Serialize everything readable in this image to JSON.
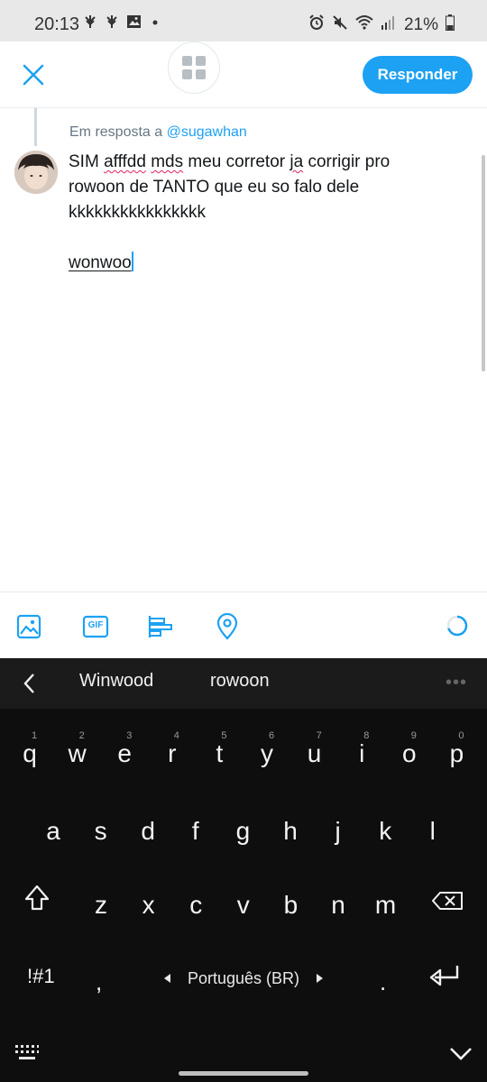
{
  "status_bar": {
    "time": "20:13",
    "battery_percent": "21%",
    "left_icons": [
      "paw-icon",
      "paw-icon",
      "gallery-icon",
      "dot-icon"
    ],
    "right_icons": [
      "alarm-icon",
      "mute-icon",
      "wifi-icon",
      "signal-icon",
      "battery-icon"
    ]
  },
  "header": {
    "reply_button_label": "Responder",
    "close_icon": "close-icon",
    "drafts_icon": "grid-icon"
  },
  "compose": {
    "reply_prefix": "Em resposta a",
    "reply_handle": "@sugawhan",
    "text_line1_a": "SIM ",
    "text_line1_word1": "afffdd",
    "text_line1_b": " ",
    "text_line1_word2": "mds",
    "text_line1_c": " meu corretor ",
    "text_line1_word3": "ja",
    "text_line1_d": " corrigir pro",
    "text_line2": "rowoon de TANTO que eu so falo dele",
    "text_line3": "kkkkkkkkkkkkkkkk",
    "text_line5_edit": "wonwoo"
  },
  "toolbar": {
    "icons": [
      "image-icon",
      "gif-icon",
      "poll-icon",
      "location-icon"
    ],
    "gif_label": "GIF",
    "char_count_progress": 0.7
  },
  "keyboard": {
    "suggestions": [
      "Winwood",
      "rowoon"
    ],
    "more": "•••",
    "row1": [
      {
        "key": "q",
        "hint": "1"
      },
      {
        "key": "w",
        "hint": "2"
      },
      {
        "key": "e",
        "hint": "3"
      },
      {
        "key": "r",
        "hint": "4"
      },
      {
        "key": "t",
        "hint": "5"
      },
      {
        "key": "y",
        "hint": "6"
      },
      {
        "key": "u",
        "hint": "7"
      },
      {
        "key": "i",
        "hint": "8"
      },
      {
        "key": "o",
        "hint": "9"
      },
      {
        "key": "p",
        "hint": "0"
      }
    ],
    "row2": [
      "a",
      "s",
      "d",
      "f",
      "g",
      "h",
      "j",
      "k",
      "l"
    ],
    "row3": [
      "z",
      "x",
      "c",
      "v",
      "b",
      "n",
      "m"
    ],
    "symbols_label": "!#1",
    "comma": ",",
    "period": ".",
    "language_label": "Português (BR)"
  }
}
